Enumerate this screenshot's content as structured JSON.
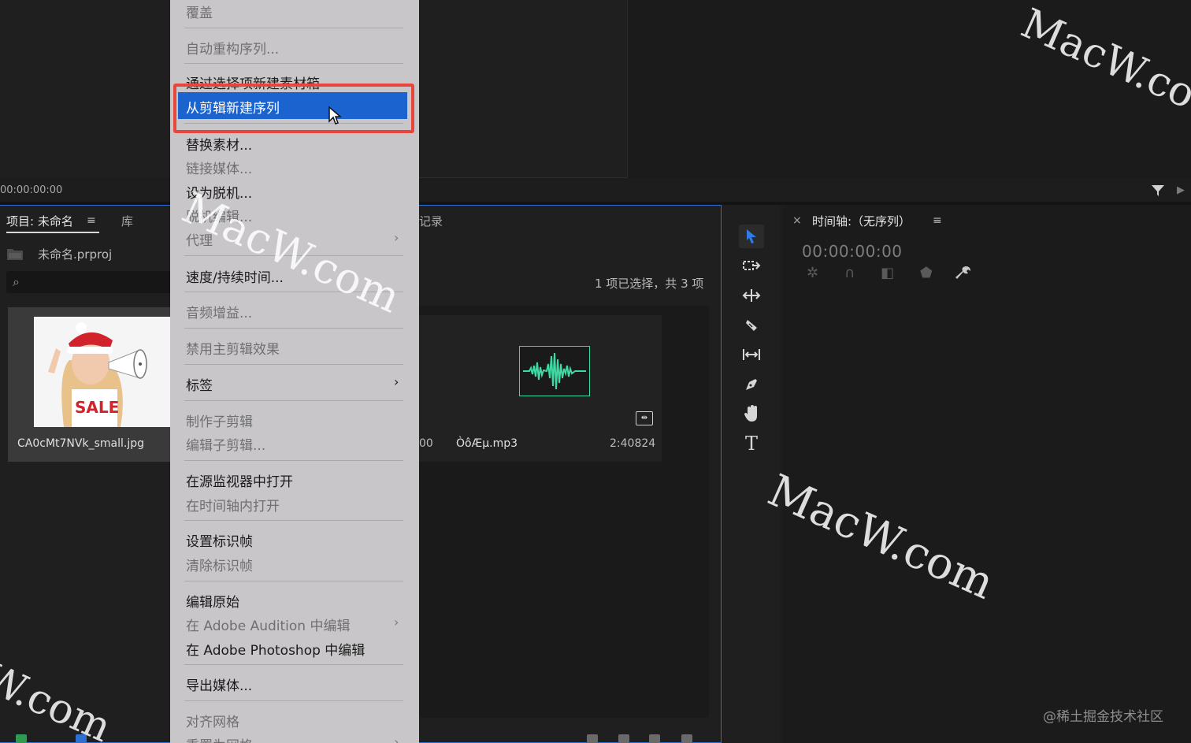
{
  "monitor": {
    "timecode": "00:00:00:00"
  },
  "project_panel": {
    "tab_label": "项目: 未命名",
    "menu_glyph": "≡",
    "library_tab": "库",
    "record_tab": "记录",
    "project_file": "未命名.prproj",
    "selection_count": "1 项已选择，共 3 项",
    "items": [
      {
        "name": "CA0cMt7NVk_small.jpg",
        "kind": "image"
      },
      {
        "name": "ÒôÆµ.mp3",
        "kind": "audio",
        "left_value": "00",
        "duration": "2:40824"
      }
    ],
    "thumb_text": "SALE"
  },
  "timeline_panel": {
    "close_glyph": "×",
    "title": "时间轴:（无序列）",
    "menu_glyph": "≡",
    "timecode": "00:00:00:00"
  },
  "context_menu": {
    "items": [
      {
        "label": "覆盖",
        "enabled": false
      },
      {
        "label": "自动重构序列...",
        "enabled": false
      },
      {
        "label": "通过选择项新建素材箱",
        "enabled": true
      },
      {
        "label": "从剪辑新建序列",
        "enabled": true,
        "highlighted": true
      },
      {
        "label": "替换素材...",
        "enabled": true
      },
      {
        "label": "链接媒体...",
        "enabled": false
      },
      {
        "label": "设为脱机...",
        "enabled": true
      },
      {
        "label": "脱机编辑...",
        "enabled": false
      },
      {
        "label": "代理",
        "enabled": false,
        "submenu": true
      },
      {
        "label": "速度/持续时间...",
        "enabled": true
      },
      {
        "label": "音频增益...",
        "enabled": false
      },
      {
        "label": "禁用主剪辑效果",
        "enabled": false
      },
      {
        "label": "标签",
        "enabled": true,
        "submenu": true
      },
      {
        "label": "制作子剪辑",
        "enabled": false
      },
      {
        "label": "编辑子剪辑...",
        "enabled": false
      },
      {
        "label": "在源监视器中打开",
        "enabled": true
      },
      {
        "label": "在时间轴内打开",
        "enabled": false
      },
      {
        "label": "设置标识帧",
        "enabled": true
      },
      {
        "label": "清除标识帧",
        "enabled": false
      },
      {
        "label": "编辑原始",
        "enabled": true
      },
      {
        "label": "在 Adobe Audition 中编辑",
        "enabled": false,
        "submenu": true
      },
      {
        "label": "在 Adobe Photoshop 中编辑",
        "enabled": true
      },
      {
        "label": "导出媒体...",
        "enabled": true
      },
      {
        "label": "对齐网格",
        "enabled": false
      },
      {
        "label": "重置为网格",
        "enabled": false,
        "submenu": true
      }
    ]
  },
  "watermarks": {
    "macw": "MacW.com",
    "macw_partial_top": "MacW.co",
    "macw_partial_bottom": "W.com",
    "credit": "@稀土掘金技术社区"
  },
  "colors": {
    "highlight_blue": "#1b63cf",
    "highlight_frame": "#e8453c",
    "panel_focus_border": "#2e6fd1",
    "waveform": "#3fd9a4",
    "menu_bg": "#c8c6c8"
  },
  "icons": {
    "tools": [
      "selection-tool-icon",
      "track-select-tool-icon",
      "ripple-edit-tool-icon",
      "razor-tool-icon",
      "slip-tool-icon",
      "pen-tool-icon",
      "hand-tool-icon",
      "type-tool-icon"
    ],
    "timeline_tools": [
      "snap-icon",
      "linked-selection-icon",
      "add-marker-icon",
      "marker-icon",
      "wrench-icon"
    ]
  }
}
